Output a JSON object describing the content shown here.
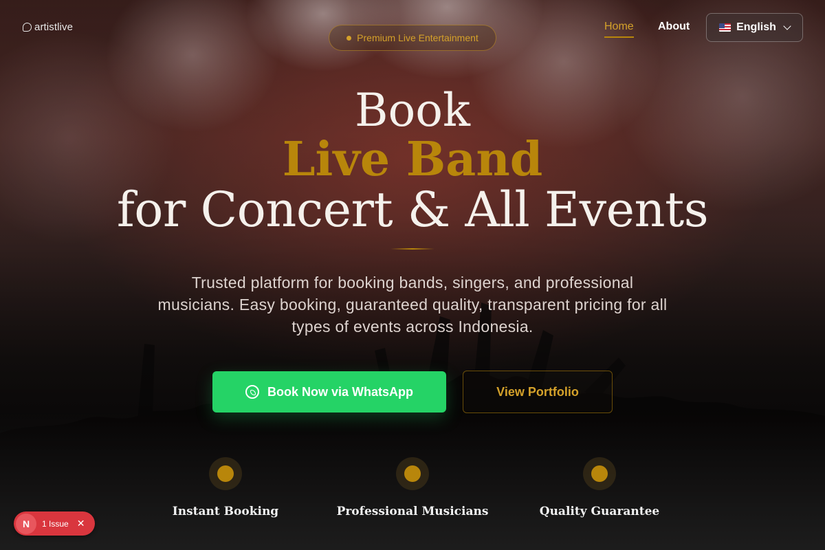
{
  "header": {
    "logo_text": "artistlive",
    "badge_text": "Premium Live Entertainment",
    "nav": [
      {
        "label": "Home",
        "active": true
      },
      {
        "label": "About",
        "active": false
      }
    ],
    "language": {
      "label": "English",
      "flag": "us-flag-icon"
    }
  },
  "hero": {
    "line1": "Book",
    "line2": "Live Band",
    "line3": "for Concert & All Events",
    "subtitle": "Trusted platform for booking bands, singers, and professional musicians. Easy booking, guaranteed quality, transparent pricing for all types of events across Indonesia."
  },
  "actions": {
    "whatsapp_label": "Book Now via WhatsApp",
    "portfolio_label": "View Portfolio"
  },
  "features": [
    {
      "label": "Instant Booking"
    },
    {
      "label": "Professional Musicians"
    },
    {
      "label": "Quality Guarantee"
    }
  ],
  "dev_overlay": {
    "badge_letter": "N",
    "issue_text": "1 Issue"
  },
  "colors": {
    "accent": "#b8860b",
    "whatsapp": "#25d366",
    "issue": "#d9363e"
  }
}
